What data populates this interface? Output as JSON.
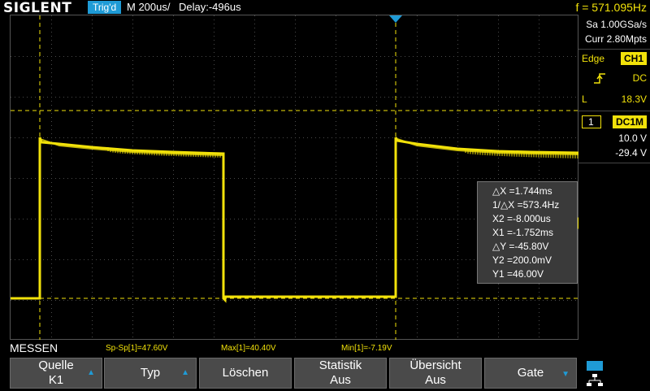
{
  "header": {
    "brand": "SIGLENT",
    "trigger_state": "Trig'd",
    "timebase": "M 200us/",
    "delay": "Delay:-496us",
    "frequency": "f = 571.095Hz"
  },
  "side_panel": {
    "sample_rate": "Sa 1.00GSa/s",
    "memory_depth": "Curr 2.80Mpts",
    "trigger_type": "Edge",
    "trigger_source": "CH1",
    "slope_icon": "rising-edge-icon",
    "coupling": "DC",
    "trigger_level_label": "L",
    "trigger_level": "18.3V",
    "channel_number": "1",
    "channel_coupling": "DC1M",
    "volts_per_div": "10.0 V",
    "offset": "-29.4 V"
  },
  "cursor_readout": {
    "delta_x": "△X =1.744ms",
    "inv_delta_x": "1/△X =573.4Hz",
    "x2": "X2 =-8.000us",
    "x1": "X1 =-1.752ms",
    "delta_y": "△Y =-45.80V",
    "y2": "Y2 =200.0mV",
    "y1": "Y1 =46.00V"
  },
  "measurements": {
    "title": "MESSEN",
    "items": [
      "Sp-Sp[1]=47.60V",
      "Max[1]=40.40V",
      "Min[1]=-7.19V"
    ]
  },
  "softkeys": [
    {
      "line1": "Quelle",
      "line2": "K1",
      "arrow": "▲"
    },
    {
      "line1": "Typ",
      "line2": "",
      "arrow": "▲"
    },
    {
      "line1": "Löschen",
      "line2": "",
      "arrow": ""
    },
    {
      "line1": "Statistik",
      "line2": "Aus",
      "arrow": ""
    },
    {
      "line1": "Übersicht",
      "line2": "Aus",
      "arrow": ""
    },
    {
      "line1": "Gate",
      "line2": "",
      "arrow": "▼"
    }
  ],
  "marker_labels": {
    "channel_ground": "1"
  },
  "colors": {
    "channel1": "#f2e20a",
    "trigger_marker": "#1f9bd6",
    "grid": "#3a3a3a"
  }
}
